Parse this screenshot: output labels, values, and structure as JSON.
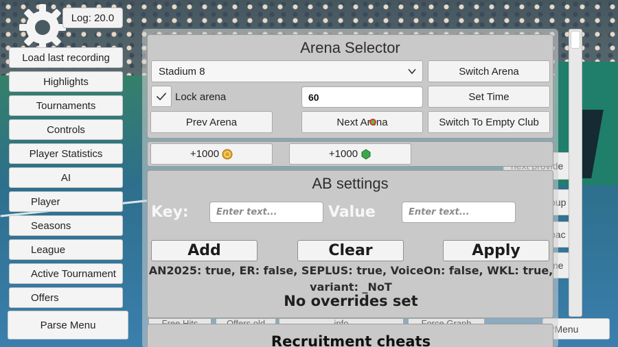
{
  "top": {
    "log_label": "Log: 20.0"
  },
  "menu": {
    "items": [
      {
        "label": "Load last recording"
      },
      {
        "label": "Highlights"
      },
      {
        "label": "Tournaments"
      },
      {
        "label": "Controls"
      },
      {
        "label": "Player Statistics"
      },
      {
        "label": "AI"
      },
      {
        "label": "Player"
      },
      {
        "label": "Seasons"
      },
      {
        "label": "League"
      },
      {
        "label": "Active Tournament"
      },
      {
        "label": "Offers"
      }
    ],
    "parse_label": "Parse Menu"
  },
  "arena": {
    "title": "Arena Selector",
    "selected_arena": "Stadium 8",
    "switch_label": "Switch Arena",
    "lock_label": "Lock arena",
    "lock_checked": true,
    "time_value": "60",
    "set_time_label": "Set Time",
    "prev_label": "Prev Arena",
    "next_label": "Next Arena",
    "empty_club_label": "Switch To Empty Club"
  },
  "currency": {
    "coins_label": "+1000",
    "gems_label": "+1000"
  },
  "ab": {
    "title": "AB settings",
    "key_label": "Key:",
    "value_label": "Value",
    "key_placeholder": "Enter text...",
    "value_placeholder": "Enter text...",
    "add_label": "Add",
    "clear_label": "Clear",
    "apply_label": "Apply",
    "status": "AN2025: true, ER: false, SEPLUS: true, VoiceOn: false, WKL: true, variant: _NoT",
    "overrides": "No overrides set"
  },
  "tabs_partial": [
    "Free Hits",
    "Offers old",
    "info",
    "Force Graph"
  ],
  "recruitment_title": "Recruitment cheats",
  "side_partial": {
    "provider": "next provide",
    "group": "oup",
    "space": "pac",
    "game": "me",
    "menu": "erMenu"
  },
  "colors": {
    "coin": "#e0a52b",
    "gem": "#3aa84a",
    "panel": "#c9c9c9"
  }
}
